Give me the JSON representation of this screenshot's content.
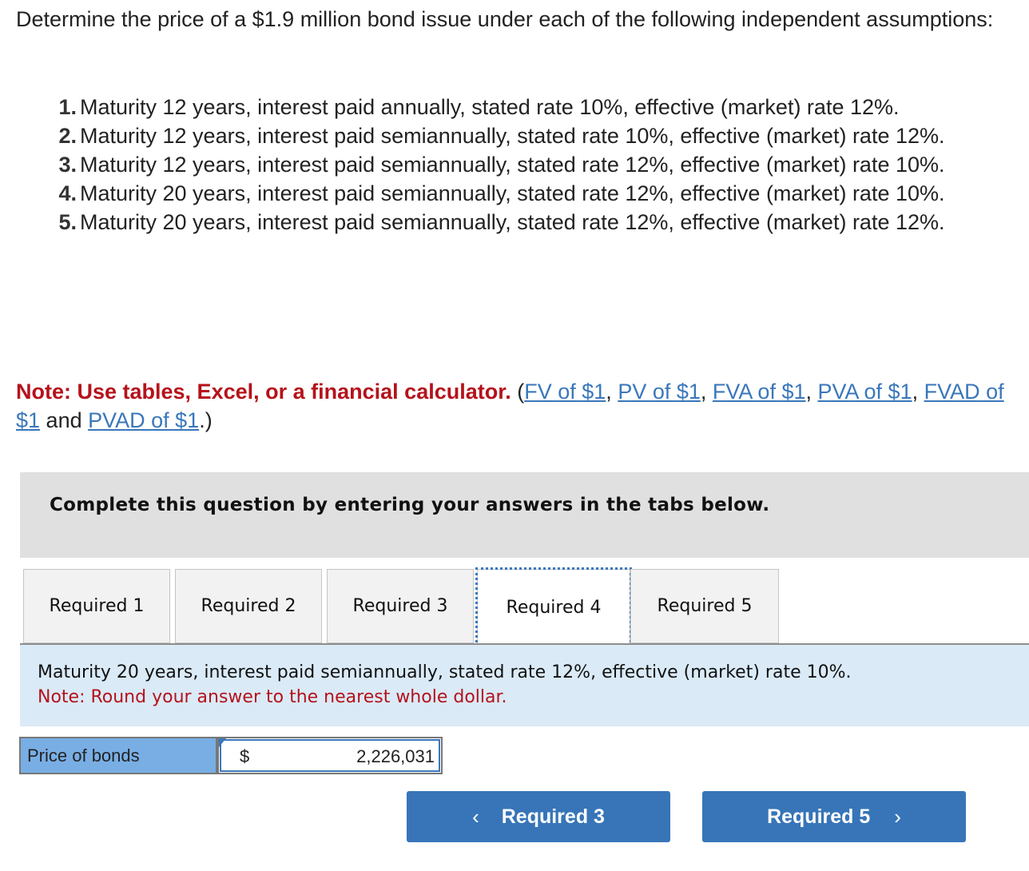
{
  "question": {
    "intro": "Determine the price of a $1.9 million bond issue under each of the following independent assumptions:",
    "items": [
      {
        "num": "1.",
        "text": "Maturity 12 years, interest paid annually, stated rate 10%, effective (market) rate 12%."
      },
      {
        "num": "2.",
        "text": "Maturity 12 years, interest paid semiannually, stated rate 10%, effective (market) rate 12%."
      },
      {
        "num": "3.",
        "text": "Maturity 12 years, interest paid semiannually, stated rate 12%, effective (market) rate 10%."
      },
      {
        "num": "4.",
        "text": "Maturity 20 years, interest paid semiannually, stated rate 12%, effective (market) rate 10%."
      },
      {
        "num": "5.",
        "text": "Maturity 20 years, interest paid semiannually, stated rate 12%, effective (market) rate 12%."
      }
    ],
    "note_red": "Note: Use tables, Excel, or a financial calculator.",
    "links": [
      "FV of $1",
      "PV of $1",
      "FVA of $1",
      "PVA of $1",
      "FVAD of $1",
      "PVAD of $1"
    ],
    "sep_comma": ", ",
    "sep_and": " and ",
    "open_paren": " (",
    "close_paren": ".)"
  },
  "instruction": "Complete this question by entering your answers in the tabs below.",
  "tabs": [
    {
      "label": "Required 1",
      "active": false
    },
    {
      "label": "Required 2",
      "active": false
    },
    {
      "label": "Required 3",
      "active": false
    },
    {
      "label": "Required 4",
      "active": true
    },
    {
      "label": "Required 5",
      "active": false
    }
  ],
  "panel": {
    "description": "Maturity 20 years, interest paid semiannually, stated rate 12%, effective (market) rate 10%.",
    "round_note": "Note: Round your answer to the nearest whole dollar.",
    "answer_label": "Price of bonds",
    "currency": "$",
    "answer_value": "2,226,031"
  },
  "nav": {
    "prev_label": "Required 3",
    "next_label": "Required 5",
    "prev_icon": "‹",
    "next_icon": "›"
  }
}
